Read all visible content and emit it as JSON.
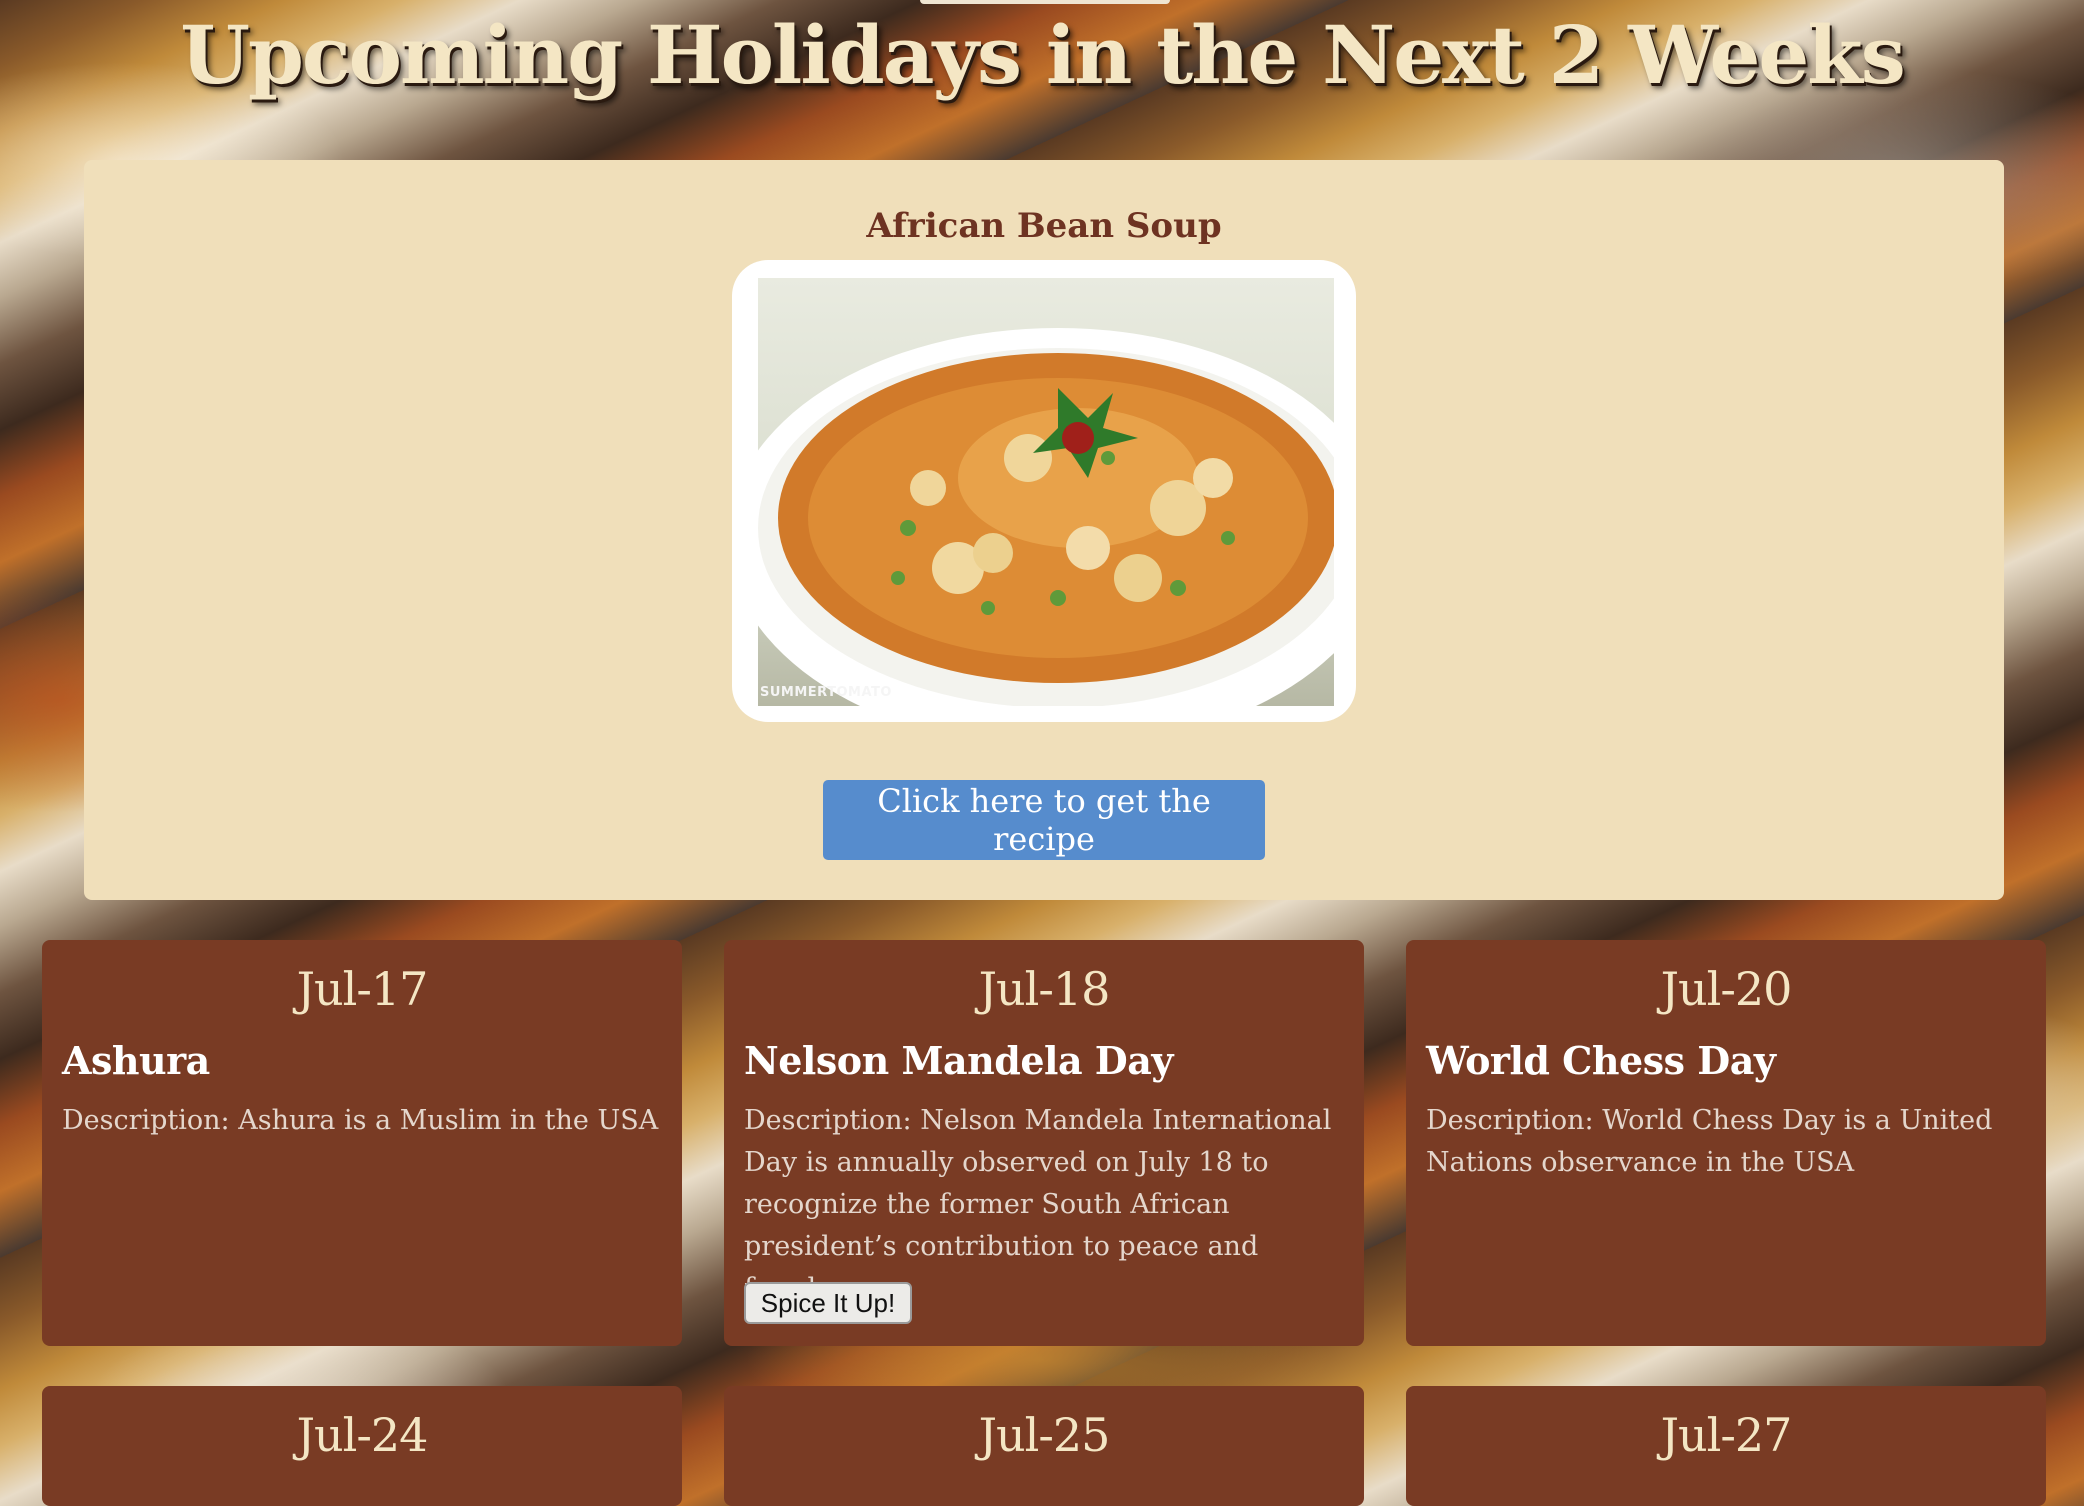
{
  "page": {
    "title": "Upcoming Holidays in the Next 2 Weeks"
  },
  "featured": {
    "title": "African Bean Soup",
    "photo_watermark": "SUMMERTOMATO",
    "button_label": "Click here to get the recipe"
  },
  "holidays": [
    {
      "date": "Jul-17",
      "name": "Ashura",
      "description": "Description: Ashura is a Muslim in the USA"
    },
    {
      "date": "Jul-18",
      "name": "Nelson Mandela Day",
      "description": "Description: Nelson Mandela International Day is annually observed on July 18 to recognize the former South African president’s contribution to peace and freedom.",
      "button_label": "Spice It Up!"
    },
    {
      "date": "Jul-20",
      "name": "World Chess Day",
      "description": "Description: World Chess Day is a United Nations observance in the USA"
    },
    {
      "date": "Jul-24",
      "name": "",
      "description": ""
    },
    {
      "date": "Jul-25",
      "name": "",
      "description": ""
    },
    {
      "date": "Jul-27",
      "name": "",
      "description": ""
    }
  ],
  "colors": {
    "title_text": "#f4e6c4",
    "featured_panel": "#f0dfba",
    "featured_title": "#6e3322",
    "recipe_button": "#568ccd",
    "card_background": "#793b24"
  }
}
